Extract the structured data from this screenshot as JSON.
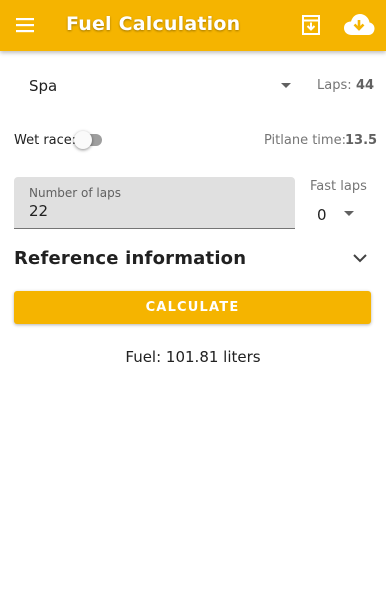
{
  "app_bar": {
    "title": "Fuel Calculation",
    "background_color": "#f5b400",
    "icons": [
      "menu-icon",
      "save-to-file-icon",
      "cloud-download-icon"
    ]
  },
  "track": {
    "selected": "Spa"
  },
  "laps": {
    "label": "Laps:",
    "value": "44"
  },
  "wet_race": {
    "label": "Wet race:",
    "enabled": false
  },
  "pitlane": {
    "label": "Pitlane time:",
    "value": "13.5"
  },
  "number_of_laps": {
    "label": "Number of laps",
    "value": "22"
  },
  "fast_laps": {
    "label": "Fast laps",
    "selected": "0"
  },
  "reference": {
    "title": "Reference information",
    "expanded": false
  },
  "calculate_button": {
    "label": "CALCULATE"
  },
  "result": {
    "text": "Fuel: 101.81 liters"
  }
}
